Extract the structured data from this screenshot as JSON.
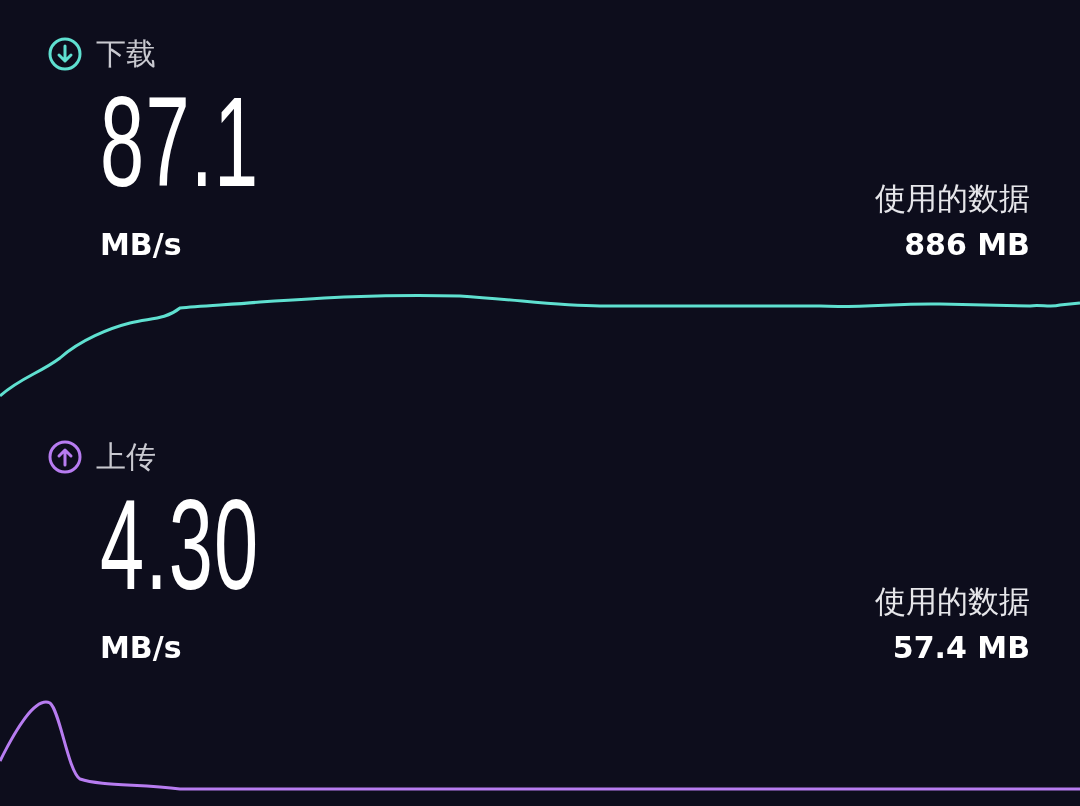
{
  "results": [
    {
      "kind": "download",
      "color": "#5fe0d0",
      "label": "下载",
      "value": "87.1",
      "unit": "MB/s",
      "data_label": "使用的数据",
      "data_value": "886 MB"
    },
    {
      "kind": "upload",
      "color": "#b77cf0",
      "label": "上传",
      "value": "4.30",
      "unit": "MB/s",
      "data_label": "使用的数据",
      "data_value": "57.4 MB"
    }
  ]
}
